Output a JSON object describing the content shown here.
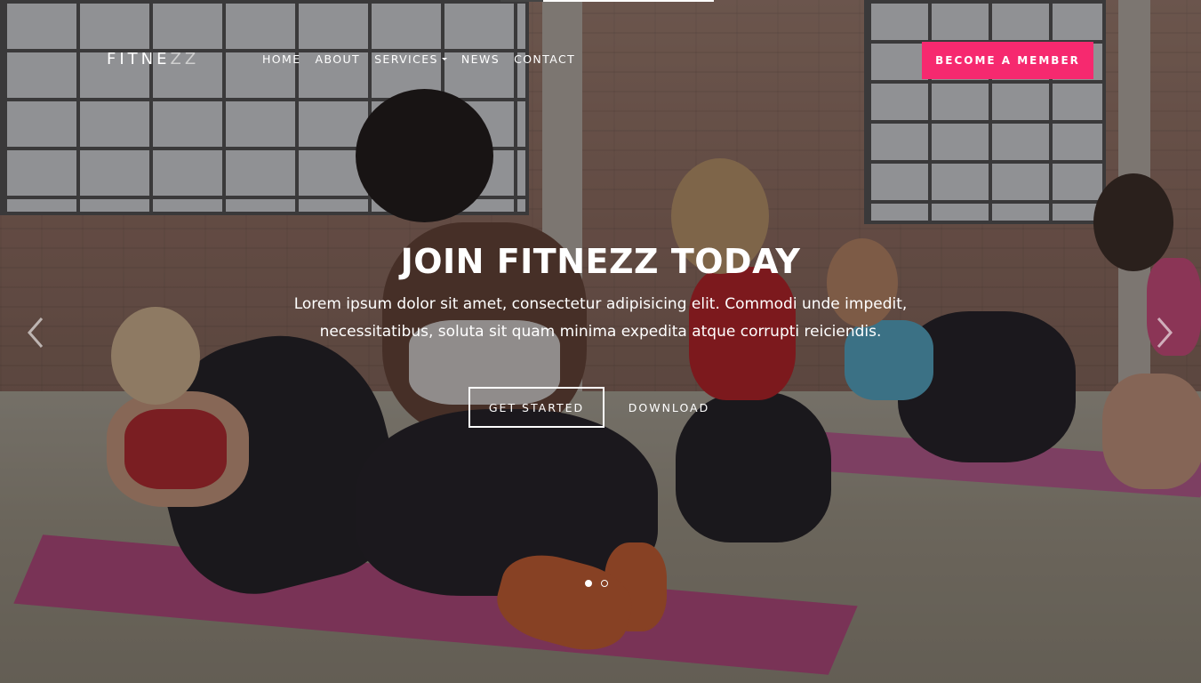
{
  "brand": {
    "logo_main": "FITNE",
    "logo_accent": "ZZ"
  },
  "nav": {
    "items": [
      {
        "label": "HOME"
      },
      {
        "label": "ABOUT"
      },
      {
        "label": "SERVICES",
        "has_dropdown": true
      },
      {
        "label": "NEWS"
      },
      {
        "label": "CONTACT"
      }
    ]
  },
  "header": {
    "cta_label": "BECOME A MEMBER"
  },
  "hero": {
    "title": "JOIN FITNEZZ TODAY",
    "text": "Lorem ipsum dolor sit amet, consectetur adipisicing elit. Commodi unde impedit, necessitatibus, soluta sit quam minima expedita atque corrupti reiciendis.",
    "primary_button": "GET STARTED",
    "secondary_button": "DOWNLOAD"
  },
  "carousel": {
    "slide_count": 2,
    "active_slide": 1,
    "prev_icon": "chevron-left-icon",
    "next_icon": "chevron-right-icon"
  },
  "colors": {
    "accent": "#f6296f",
    "text": "#ffffff"
  }
}
